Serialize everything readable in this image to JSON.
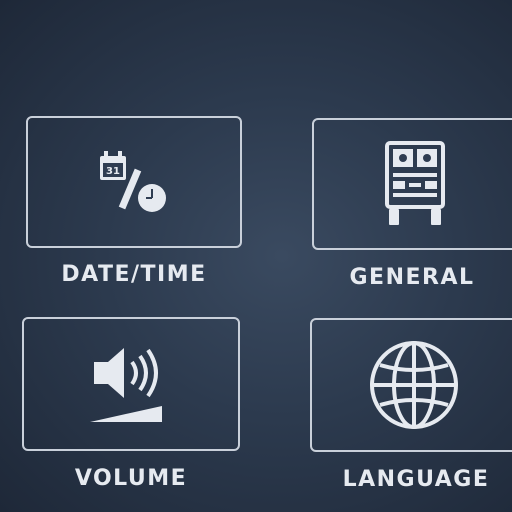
{
  "menu": {
    "tiles": [
      {
        "label": "DATE/TIME",
        "icon": "calendar-clock-icon",
        "calendar_day": "31"
      },
      {
        "label": "GENERAL",
        "icon": "truck-front-icon"
      },
      {
        "label": "VOLUME",
        "icon": "speaker-volume-icon"
      },
      {
        "label": "LANGUAGE",
        "icon": "globe-icon"
      }
    ]
  },
  "colors": {
    "background": "#2c3a4e",
    "border": "#c9d0da",
    "icon": "#e6eaf0",
    "text": "#e6eaf0"
  }
}
